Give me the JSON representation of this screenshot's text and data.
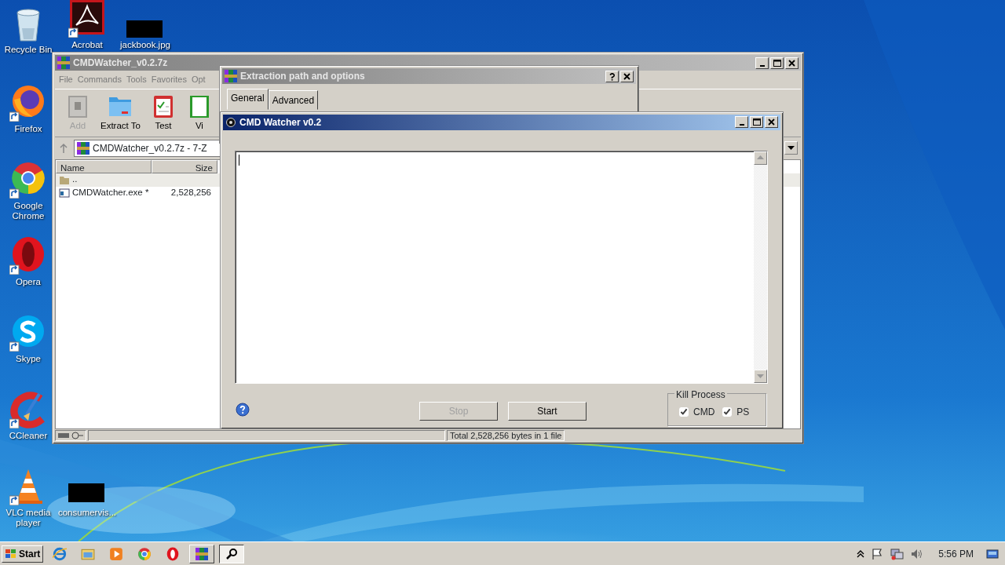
{
  "desktop_icons": [
    {
      "label": "Recycle Bin"
    },
    {
      "label": "Acrobat"
    },
    {
      "label": "jackbook.jpg"
    },
    {
      "label": "Firefox"
    },
    {
      "label": "Google Chrome"
    },
    {
      "label": "Opera"
    },
    {
      "label": "Skype"
    },
    {
      "label": "CCleaner"
    },
    {
      "label": "VLC media player"
    },
    {
      "label": "consumervis..."
    }
  ],
  "archive_window": {
    "title": "CMDWatcher_v0.2.7z",
    "menu": [
      "File",
      "Commands",
      "Tools",
      "Favorites",
      "Opt"
    ],
    "toolbar": [
      {
        "label": "Add",
        "disabled": true
      },
      {
        "label": "Extract To",
        "disabled": false
      },
      {
        "label": "Test",
        "disabled": false
      },
      {
        "label": "Vi",
        "disabled": false
      }
    ],
    "address": "CMDWatcher_v0.2.7z - 7-Z",
    "table": {
      "columns": [
        "Name",
        "Size"
      ],
      "rows": [
        {
          "name": ".."
        },
        {
          "name": "CMDWatcher.exe *",
          "size": "2,528,256"
        }
      ]
    },
    "status_bar": "Total 2,528,256 bytes in 1 file"
  },
  "extraction_dialog": {
    "title": "Extraction path and options",
    "tabs": [
      {
        "label": "General",
        "selected": true
      },
      {
        "label": "Advanced",
        "selected": false
      }
    ]
  },
  "watcher_window": {
    "title": "CMD Watcher v0.2",
    "buttons": [
      {
        "label": "Stop",
        "disabled": true
      },
      {
        "label": "Start",
        "disabled": false
      }
    ],
    "kill_process": {
      "label": "Kill Process",
      "options": [
        {
          "label": "CMD",
          "checked": true
        },
        {
          "label": "PS",
          "checked": true
        }
      ]
    }
  },
  "taskbar": {
    "start": "Start",
    "programs": [
      {
        "selected": false
      },
      {
        "selected": true
      }
    ],
    "clock": "5:56 PM"
  }
}
